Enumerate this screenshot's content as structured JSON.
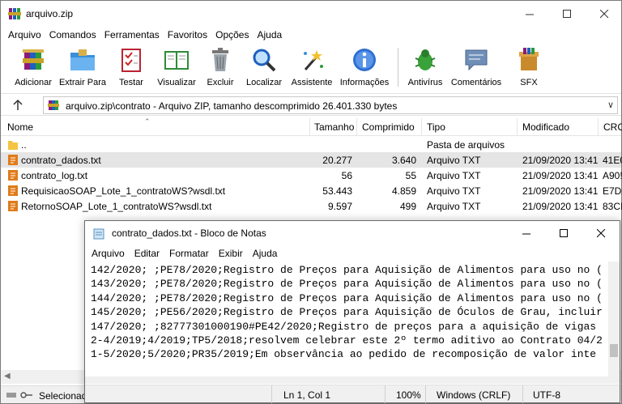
{
  "rar_window": {
    "title": "arquivo.zip",
    "menu": [
      "Arquivo",
      "Comandos",
      "Ferramentas",
      "Favoritos",
      "Opções",
      "Ajuda"
    ],
    "toolbar": [
      {
        "label": "Adicionar",
        "icon": "add-icon"
      },
      {
        "label": "Extrair Para",
        "icon": "extract-folder-icon"
      },
      {
        "label": "Testar",
        "icon": "test-checklist-icon"
      },
      {
        "label": "Visualizar",
        "icon": "view-book-icon"
      },
      {
        "label": "Excluir",
        "icon": "trash-icon"
      },
      {
        "label": "Localizar",
        "icon": "magnifier-icon"
      },
      {
        "label": "Assistente",
        "icon": "wizard-wand-icon"
      },
      {
        "label": "Informações",
        "icon": "info-icon"
      },
      {
        "label": "Antivírus",
        "icon": "bug-icon"
      },
      {
        "label": "Comentários",
        "icon": "comment-icon"
      },
      {
        "label": "SFX",
        "icon": "sfx-box-icon"
      }
    ],
    "path": "arquivo.zip\\contrato - Arquivo ZIP, tamanho descomprimido 26.401.330 bytes",
    "columns": {
      "name": "Nome",
      "size": "Tamanho",
      "packed": "Comprimido",
      "type": "Tipo",
      "modified": "Modificado",
      "crc": "CRC"
    },
    "parent_row": {
      "name": "..",
      "type": "Pasta de arquivos"
    },
    "files": [
      {
        "name": "contrato_dados.txt",
        "size": "20.277",
        "packed": "3.640",
        "type": "Arquivo TXT",
        "modified": "21/09/2020 13:41",
        "crc": "41E0"
      },
      {
        "name": "contrato_log.txt",
        "size": "56",
        "packed": "55",
        "type": "Arquivo TXT",
        "modified": "21/09/2020 13:41",
        "crc": "A90!"
      },
      {
        "name": "RequisicaoSOAP_Lote_1_contratoWS?wsdl.txt",
        "size": "53.443",
        "packed": "4.859",
        "type": "Arquivo TXT",
        "modified": "21/09/2020 13:41",
        "crc": "E7DA"
      },
      {
        "name": "RetornoSOAP_Lote_1_contratoWS?wsdl.txt",
        "size": "9.597",
        "packed": "499",
        "type": "Arquivo TXT",
        "modified": "21/09/2020 13:41",
        "crc": "83CI"
      }
    ],
    "status": "Selecionad"
  },
  "notepad": {
    "title": "contrato_dados.txt - Bloco de Notas",
    "menu": [
      "Arquivo",
      "Editar",
      "Formatar",
      "Exibir",
      "Ajuda"
    ],
    "lines": [
      "142/2020; ;PE78/2020;Registro de Preços para Aquisição de Alimentos para uso no (",
      "143/2020; ;PE78/2020;Registro de Preços para Aquisição de Alimentos para uso no (",
      "144/2020; ;PE78/2020;Registro de Preços para Aquisição de Alimentos para uso no (",
      "145/2020; ;PE56/2020;Registro de Preços para Aquisição de Óculos de Grau, incluir",
      "147/2020; ;82777301000190#PE42/2020;Registro de preços para a aquisição de vigas",
      "2-4/2019;4/2019;TP5/2018;resolvem celebrar este 2º termo aditivo ao Contrato 04/2",
      "1-5/2020;5/2020;PR35/2019;Em observância ao pedido de recomposição de valor inte"
    ],
    "status": {
      "position": "Ln 1, Col 1",
      "zoom": "100%",
      "eol": "Windows (CRLF)",
      "encoding": "UTF-8"
    }
  }
}
